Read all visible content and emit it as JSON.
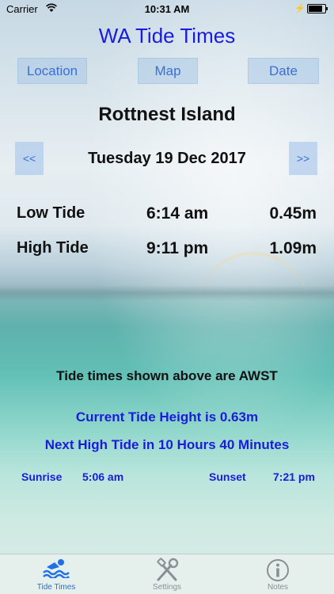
{
  "status_bar": {
    "carrier": "Carrier",
    "time": "10:31 AM"
  },
  "app": {
    "title": "WA Tide Times"
  },
  "toolbar": {
    "location_label": "Location",
    "map_label": "Map",
    "date_label": "Date"
  },
  "location": {
    "name": "Rottnest Island"
  },
  "date_nav": {
    "prev_label": "<<",
    "date": "Tuesday 19 Dec 2017",
    "next_label": ">>"
  },
  "tides": [
    {
      "type": "Low Tide",
      "time": "6:14 am",
      "height": "0.45m"
    },
    {
      "type": "High Tide",
      "time": "9:11 pm",
      "height": "1.09m"
    }
  ],
  "notes": {
    "timezone": "Tide times shown above are AWST",
    "current_height": "Current Tide Height is 0.63m",
    "next_high": "Next High Tide in 10 Hours 40 Minutes"
  },
  "sun": {
    "sunrise_label": "Sunrise",
    "sunrise_time": "5:06 am",
    "sunset_label": "Sunset",
    "sunset_time": "7:21 pm"
  },
  "tabs": [
    {
      "label": "Tide Times",
      "icon": "swimmer-icon",
      "selected": true
    },
    {
      "label": "Settings",
      "icon": "tools-icon",
      "selected": false
    },
    {
      "label": "Notes",
      "icon": "info-icon",
      "selected": false
    }
  ],
  "colors": {
    "accent": "#1a1cdb",
    "button_text": "#3a6fd8",
    "tab_active": "#1f6fe8",
    "tab_inactive": "#8a8f93"
  },
  "battery_level": 0.95
}
